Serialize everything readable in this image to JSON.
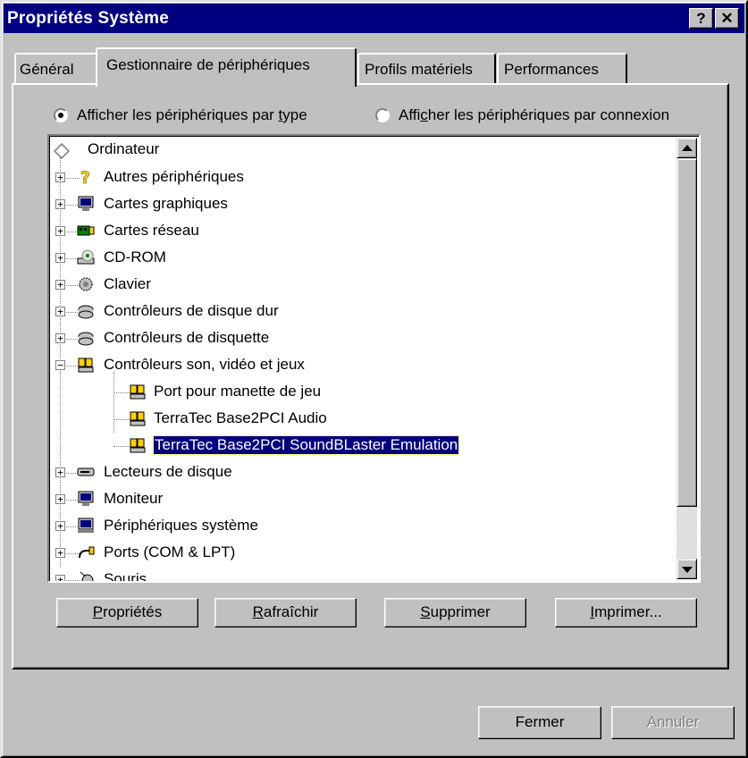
{
  "window": {
    "title": "Propriétés Système",
    "help_label": "?",
    "close_label": "✕"
  },
  "tabs": [
    {
      "label": "Général",
      "active": false
    },
    {
      "label": "Gestionnaire de périphériques",
      "active": true
    },
    {
      "label": "Profils matériels",
      "active": false
    },
    {
      "label": "Performances",
      "active": false
    }
  ],
  "view_options": {
    "by_type": {
      "label_before": "Afficher les périphériques par ",
      "label_ul": "t",
      "label_after": "ype",
      "checked": true
    },
    "by_connection": {
      "label_before": "Affi",
      "label_ul": "c",
      "label_after": "her les périphériques par connexion",
      "checked": false
    }
  },
  "tree": {
    "root": {
      "label": "Ordinateur",
      "icon": "computer-diamond-icon"
    },
    "items": [
      {
        "label": "Autres périphériques",
        "icon": "question-icon",
        "expander": "+",
        "level": 1
      },
      {
        "label": "Cartes graphiques",
        "icon": "monitor-icon",
        "expander": "+",
        "level": 1
      },
      {
        "label": "Cartes réseau",
        "icon": "network-card-icon",
        "expander": "+",
        "level": 1
      },
      {
        "label": "CD-ROM",
        "icon": "cdrom-icon",
        "expander": "+",
        "level": 1
      },
      {
        "label": "Clavier",
        "icon": "keyboard-icon",
        "expander": "+",
        "level": 1
      },
      {
        "label": "Contrôleurs de disque dur",
        "icon": "disk-controller-icon",
        "expander": "+",
        "level": 1
      },
      {
        "label": "Contrôleurs de disquette",
        "icon": "floppy-controller-icon",
        "expander": "+",
        "level": 1
      },
      {
        "label": "Contrôleurs son, vidéo et jeux",
        "icon": "sound-video-icon",
        "expander": "−",
        "level": 1
      },
      {
        "label": "Port pour manette de jeu",
        "icon": "sound-device-icon",
        "expander": "",
        "level": 2
      },
      {
        "label": "TerraTec Base2PCI Audio",
        "icon": "sound-device-icon",
        "expander": "",
        "level": 2
      },
      {
        "label": "TerraTec Base2PCI SoundBLaster Emulation",
        "icon": "sound-device-icon",
        "expander": "",
        "level": 2,
        "selected": true
      },
      {
        "label": "Lecteurs de disque",
        "icon": "disk-drive-icon",
        "expander": "+",
        "level": 1
      },
      {
        "label": "Moniteur",
        "icon": "monitor-icon",
        "expander": "+",
        "level": 1
      },
      {
        "label": "Périphériques système",
        "icon": "system-device-icon",
        "expander": "+",
        "level": 1
      },
      {
        "label": "Ports (COM & LPT)",
        "icon": "port-icon",
        "expander": "+",
        "level": 1
      },
      {
        "label": "Souris",
        "icon": "mouse-icon",
        "expander": "+",
        "level": 1
      }
    ]
  },
  "scroll": {
    "position": 0.0,
    "visible_fraction": 0.87
  },
  "buttons": {
    "properties": {
      "ul": "P",
      "rest": "ropriétés"
    },
    "refresh": {
      "ul": "R",
      "rest": "afraîchir"
    },
    "remove": {
      "ul": "S",
      "rest": "upprimer"
    },
    "print": {
      "ul": "I",
      "rest": "mprimer..."
    },
    "close": "Fermer",
    "cancel": "Annuler"
  },
  "colors": {
    "title_bg": "#000080",
    "face": "#c0c0c0",
    "selection": "#000080"
  }
}
